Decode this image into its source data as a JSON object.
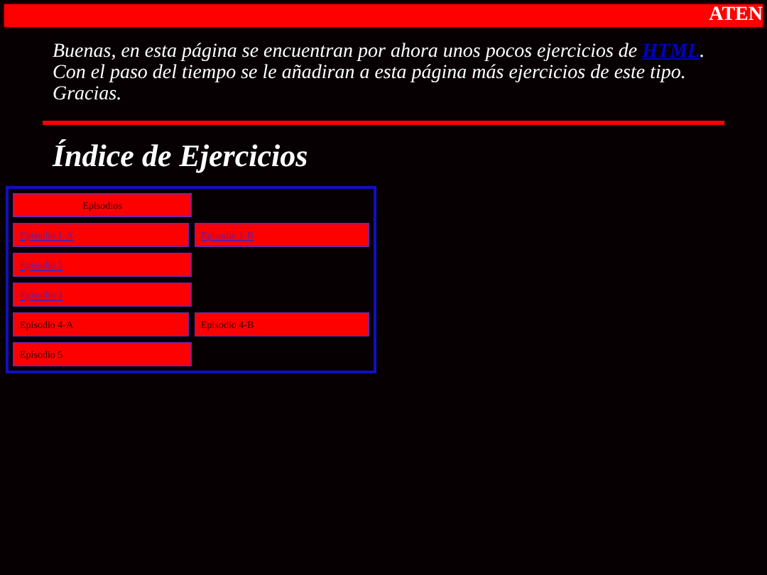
{
  "marquee": {
    "text": "ATEN"
  },
  "intro": {
    "before": "Buenas, en esta página se encuentran por ahora unos pocos ejercicios de ",
    "link": "HTML",
    "after": ". Con el paso del tiempo se le añadiran a esta página más ejercicios de este tipo. Gracias."
  },
  "heading": "Índice de Ejercicios",
  "table": {
    "header": "Episodios",
    "rows": [
      [
        {
          "label": "Episodio 1-A",
          "kind": "link"
        },
        {
          "label": "Episodio 1-B",
          "kind": "link"
        }
      ],
      [
        {
          "label": "Episodio 2",
          "kind": "link"
        }
      ],
      [
        {
          "label": "Episodio 3",
          "kind": "link"
        }
      ],
      [
        {
          "label": "Episodio 4-A",
          "kind": "text"
        },
        {
          "label": "Episodio 4-B",
          "kind": "text"
        }
      ],
      [
        {
          "label": "Episodio 5",
          "kind": "text"
        }
      ]
    ]
  }
}
